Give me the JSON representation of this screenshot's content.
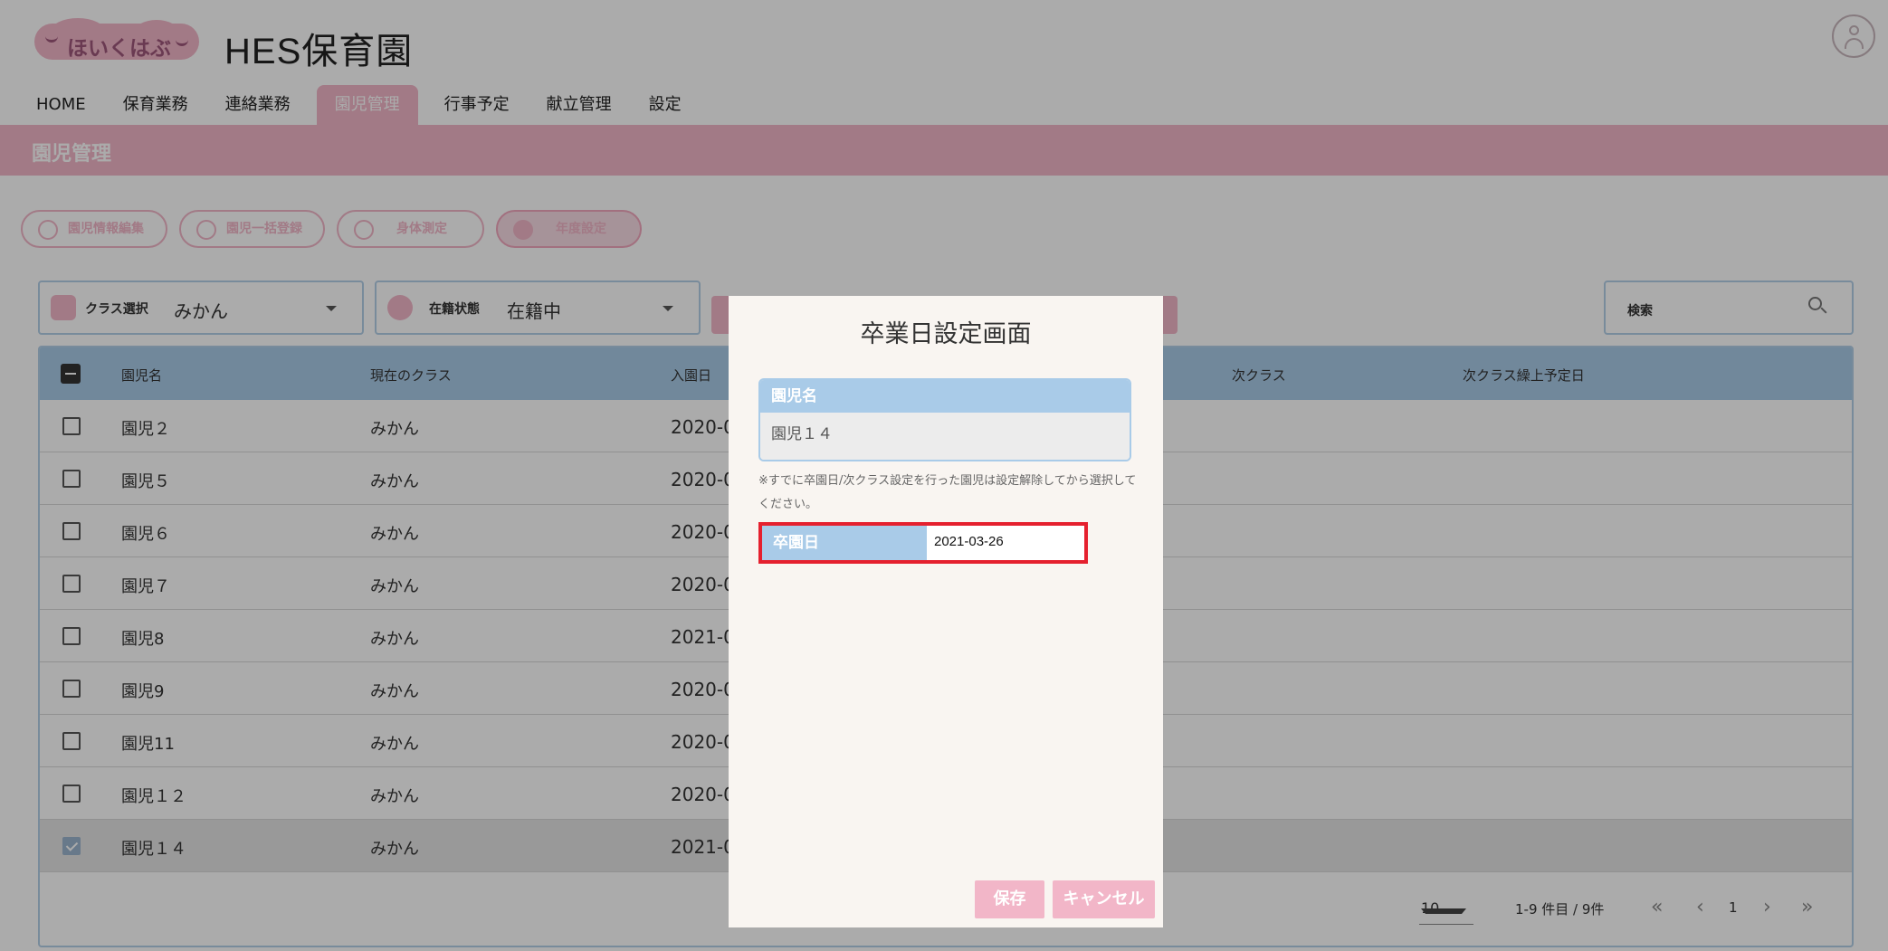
{
  "header": {
    "logo_text": "ほいくはぶ",
    "org_name": "HES保育園"
  },
  "nav": {
    "items": [
      "HOME",
      "保育業務",
      "連絡業務",
      "園児管理",
      "行事予定",
      "献立管理",
      "設定"
    ],
    "active_index": 3
  },
  "page": {
    "title": "園児管理"
  },
  "actions": {
    "edit_info": "園児情報編集",
    "bulk_register": "園児一括登録",
    "body_measure": "身体測定",
    "year_setting": "年度設定"
  },
  "filters": {
    "class_label": "クラス選択",
    "class_value": "みかん",
    "status_label": "在籍状態",
    "status_value": "在籍中",
    "search_label": "検索"
  },
  "table": {
    "headers": [
      "園児名",
      "現在のクラス",
      "入園日",
      "次クラス",
      "次クラス繰上予定日"
    ],
    "rows": [
      {
        "name": "園児２",
        "class": "みかん",
        "entry": "2020-0",
        "checked": false
      },
      {
        "name": "園児５",
        "class": "みかん",
        "entry": "2020-0",
        "checked": false
      },
      {
        "name": "園児６",
        "class": "みかん",
        "entry": "2020-0",
        "checked": false
      },
      {
        "name": "園児７",
        "class": "みかん",
        "entry": "2020-0",
        "checked": false
      },
      {
        "name": "園児8",
        "class": "みかん",
        "entry": "2021-0",
        "checked": false
      },
      {
        "name": "園児9",
        "class": "みかん",
        "entry": "2020-0",
        "checked": false
      },
      {
        "name": "園児11",
        "class": "みかん",
        "entry": "2020-0",
        "checked": false
      },
      {
        "name": "園児１２",
        "class": "みかん",
        "entry": "2020-0",
        "checked": false
      },
      {
        "name": "園児１４",
        "class": "みかん",
        "entry": "2021-0",
        "checked": true
      }
    ]
  },
  "pagination": {
    "per_page": "10",
    "range": "1-9 件目 / 9件",
    "page": "1",
    "first": "«",
    "prev": "‹",
    "next": "›",
    "last": "»"
  },
  "modal": {
    "title": "卒業日設定画面",
    "name_header": "園児名",
    "name_value": "園児１４",
    "note": "※すでに卒園日/次クラス設定を行った園児は設定解除してから選択してください。",
    "date_label": "卒園日",
    "date_value": "2021-03-26",
    "save": "保存",
    "cancel": "キャンセル"
  },
  "colors": {
    "accent_pink": "#f2b6c8",
    "table_header_blue": "#a9cbe8",
    "highlight_red": "#e5202e"
  }
}
